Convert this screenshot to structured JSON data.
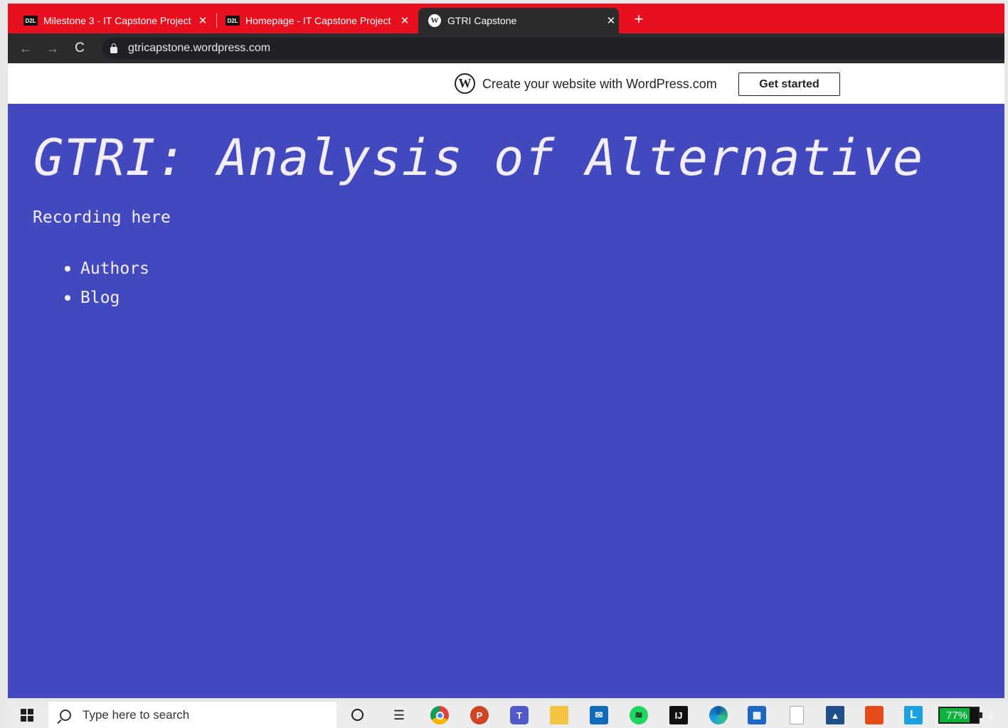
{
  "browser": {
    "tabs": [
      {
        "favicon": "D2L",
        "title": "Milestone 3 - IT Capstone Project",
        "close": "✕",
        "active": false
      },
      {
        "favicon": "D2L",
        "title": "Homepage - IT Capstone Project",
        "close": "✕",
        "active": false
      },
      {
        "favicon": "wordpress-icon",
        "title": "GTRI Capstone",
        "close": "✕",
        "active": true
      }
    ],
    "new_tab": "+",
    "nav": {
      "back": "←",
      "forward": "→",
      "reload": "C"
    },
    "url": "gtricapstone.wordpress.com",
    "colors": {
      "tabstrip": "#e8101e",
      "toolbar": "#2b2b2d"
    }
  },
  "wp_banner": {
    "logo": "W",
    "text": "Create your website with WordPress.com",
    "button": "Get started"
  },
  "page": {
    "title": "GTRI: Analysis of Alternative",
    "tagline": "Recording here",
    "menu": [
      "Authors",
      "Blog"
    ],
    "background": "#4249bf"
  },
  "taskbar": {
    "search_placeholder": "Type here to search",
    "icons": [
      "windows-start-icon",
      "cortana-icon",
      "task-view-icon",
      "chrome-icon",
      "powerpoint-icon",
      "teams-icon",
      "file-explorer-icon",
      "mail-icon",
      "spotify-icon",
      "intellij-icon",
      "edge-icon",
      "store-icon",
      "document-icon",
      "photos-icon",
      "office-icon",
      "l-app-icon"
    ],
    "battery_percent": "77%",
    "battery_level": 0.77,
    "letters": {
      "ppt": "P",
      "teams": "T",
      "idea": "IJ",
      "lapp": "L"
    }
  }
}
